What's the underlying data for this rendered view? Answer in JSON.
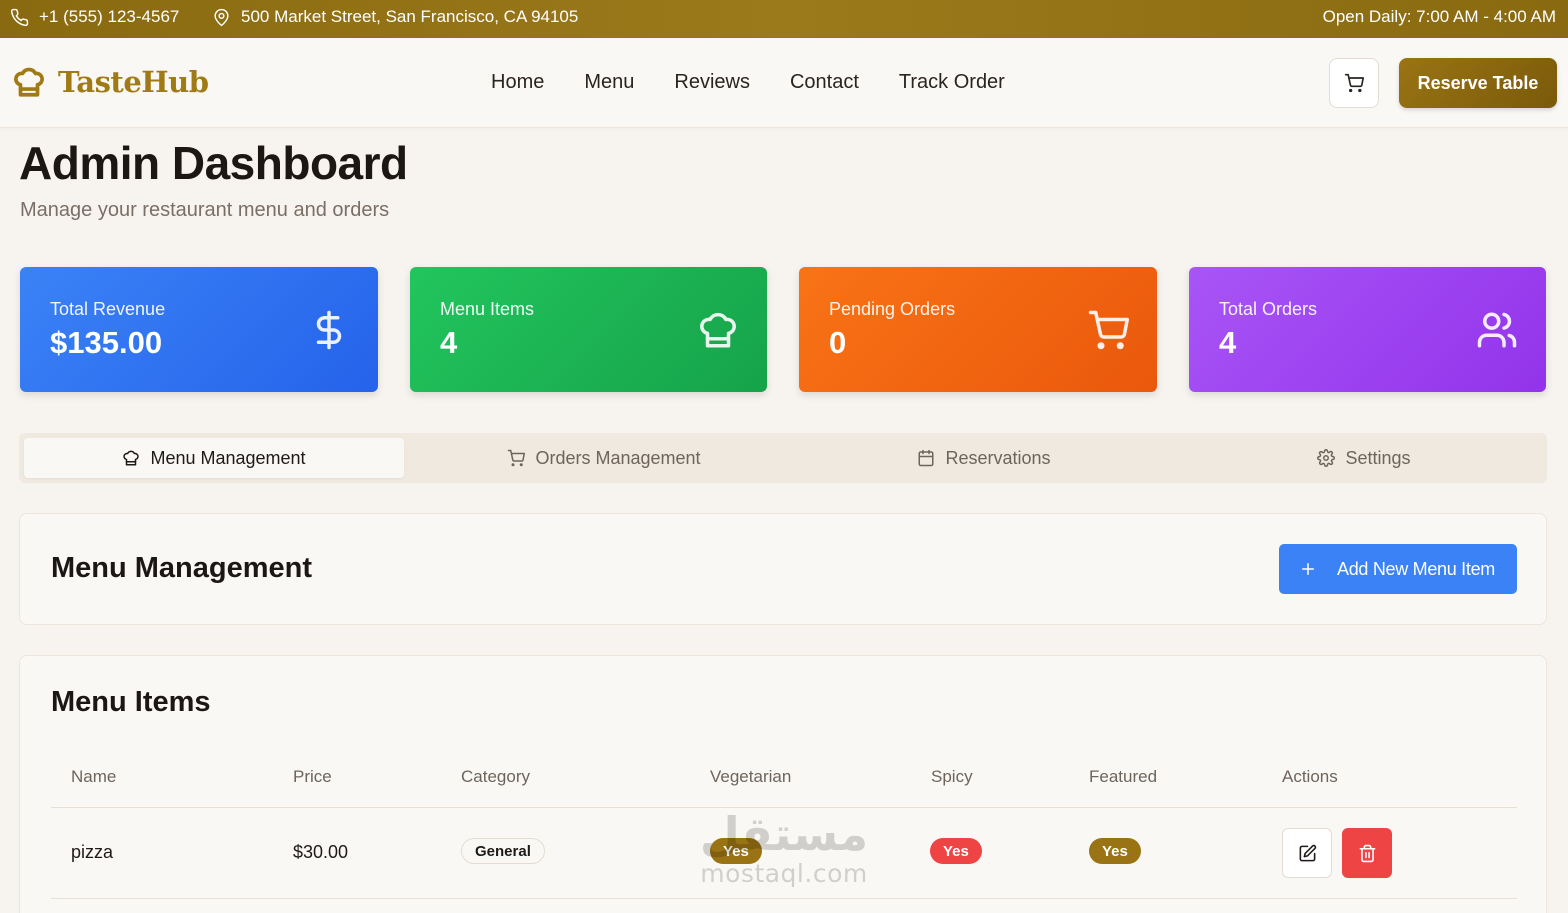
{
  "topbar": {
    "phone": "+1 (555) 123-4567",
    "address": "500 Market Street, San Francisco, CA 94105",
    "hours": "Open Daily: 7:00 AM - 4:00 AM",
    "phone_icon": "phone-icon",
    "address_icon": "map-pin-icon"
  },
  "navbar": {
    "logo_text": "TasteHub",
    "logo_icon": "chef-hat-icon",
    "links": [
      "Home",
      "Menu",
      "Reviews",
      "Contact",
      "Track Order"
    ],
    "cart_icon": "cart-icon",
    "reserve_label": "Reserve Table"
  },
  "header": {
    "title": "Admin Dashboard",
    "subtitle": "Manage your restaurant menu and orders"
  },
  "stats": [
    {
      "label": "Total Revenue",
      "value": "$135.00",
      "icon": "dollar-icon",
      "color": "#3b82f6"
    },
    {
      "label": "Menu Items",
      "value": "4",
      "icon": "chef-hat-icon",
      "color": "#22c55e"
    },
    {
      "label": "Pending Orders",
      "value": "0",
      "icon": "cart-icon",
      "color": "#f97316"
    },
    {
      "label": "Total Orders",
      "value": "4",
      "icon": "users-icon",
      "color": "#a855f7"
    }
  ],
  "tabs": [
    {
      "label": "Menu Management",
      "icon": "chef-hat-icon",
      "active": true
    },
    {
      "label": "Orders Management",
      "icon": "cart-icon",
      "active": false
    },
    {
      "label": "Reservations",
      "icon": "calendar-icon",
      "active": false
    },
    {
      "label": "Settings",
      "icon": "gear-icon",
      "active": false
    }
  ],
  "menu_management": {
    "title": "Menu Management",
    "add_label": "Add New Menu Item"
  },
  "menu_items": {
    "title": "Menu Items",
    "columns": [
      "Name",
      "Price",
      "Category",
      "Vegetarian",
      "Spicy",
      "Featured",
      "Actions"
    ],
    "rows": [
      {
        "name": "pizza",
        "price": "$30.00",
        "category": "General",
        "vegetarian": "Yes",
        "spicy": "Yes",
        "featured": "Yes"
      }
    ]
  },
  "watermark": {
    "arabic": "مستقل",
    "latin": "mostaql.com"
  },
  "colors": {
    "brand_gold": "#9a7414",
    "primary_blue": "#3b82f6",
    "danger_red": "#ef4444"
  }
}
